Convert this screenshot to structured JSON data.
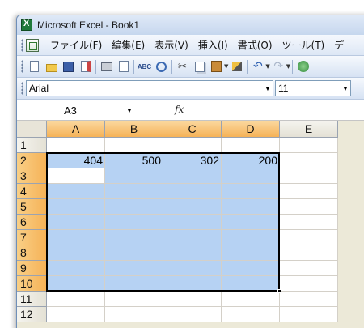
{
  "window": {
    "title": "Microsoft Excel - Book1"
  },
  "menu": [
    "ファイル(F)",
    "編集(E)",
    "表示(V)",
    "挿入(I)",
    "書式(O)",
    "ツール(T)",
    "デ"
  ],
  "format": {
    "font": "Arial",
    "size": "11"
  },
  "formula_bar": {
    "name_box": "A3",
    "fx": "fx",
    "content": ""
  },
  "sheet": {
    "columns": [
      "A",
      "B",
      "C",
      "D",
      "E"
    ],
    "selected_columns": [
      "A",
      "B",
      "C",
      "D"
    ],
    "rows": [
      "1",
      "2",
      "3",
      "4",
      "5",
      "6",
      "7",
      "8",
      "9",
      "10",
      "11",
      "12"
    ],
    "selected_rows": [
      "2",
      "3",
      "4",
      "5",
      "6",
      "7",
      "8",
      "9",
      "10"
    ],
    "active_cell": "A3",
    "values": {
      "A2": "404",
      "B2": "500",
      "C2": "302",
      "D2": "200"
    }
  }
}
